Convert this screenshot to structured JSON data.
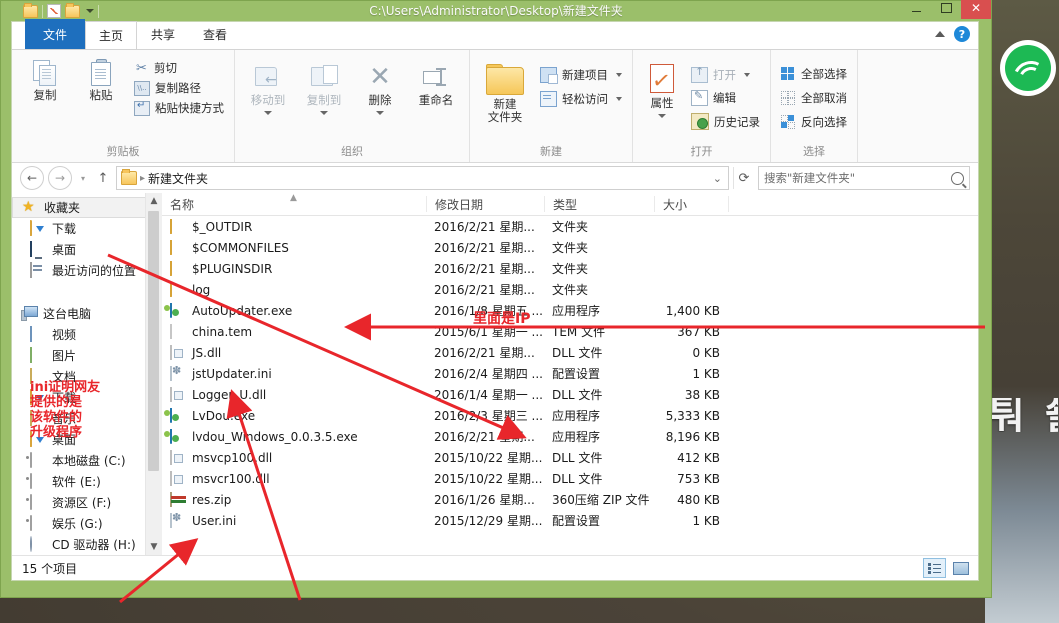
{
  "window": {
    "title": "C:\\Users\\Administrator\\Desktop\\新建文件夹",
    "minimize": "—",
    "maximize": "▢",
    "close": "✕"
  },
  "ribbon": {
    "tabs": [
      {
        "label": "文件",
        "type": "file"
      },
      {
        "label": "主页",
        "type": "active"
      },
      {
        "label": "共享",
        "type": "normal"
      },
      {
        "label": "查看",
        "type": "normal"
      }
    ],
    "collapse_icon": "chevron-up-icon",
    "help_label": "?",
    "groups": [
      {
        "name": "剪贴板",
        "big": [
          {
            "label": "复制",
            "icon": "copy-icon"
          },
          {
            "label": "粘贴",
            "icon": "paste-icon"
          }
        ],
        "small": [
          {
            "label": "剪切",
            "icon": "scissors-icon"
          },
          {
            "label": "复制路径",
            "icon": "copy-path-icon"
          },
          {
            "label": "粘贴快捷方式",
            "icon": "paste-shortcut-icon"
          }
        ]
      },
      {
        "name": "组织",
        "big": [
          {
            "label": "移动到",
            "icon": "move-to-icon"
          },
          {
            "label": "复制到",
            "icon": "copy-to-icon"
          },
          {
            "label": "删除",
            "icon": "delete-icon"
          },
          {
            "label": "重命名",
            "icon": "rename-icon"
          }
        ]
      },
      {
        "name": "新建",
        "big": [
          {
            "label": "新建\n文件夹",
            "icon": "new-folder-icon"
          }
        ],
        "small": [
          {
            "label": "新建项目",
            "icon": "new-item-icon"
          },
          {
            "label": "轻松访问",
            "icon": "easy-access-icon"
          }
        ]
      },
      {
        "name": "打开",
        "big": [
          {
            "label": "属性",
            "icon": "properties-icon"
          }
        ],
        "small": [
          {
            "label": "打开",
            "icon": "open-icon"
          },
          {
            "label": "编辑",
            "icon": "edit-icon"
          },
          {
            "label": "历史记录",
            "icon": "history-icon"
          }
        ]
      },
      {
        "name": "选择",
        "small": [
          {
            "label": "全部选择",
            "icon": "select-all-icon"
          },
          {
            "label": "全部取消",
            "icon": "select-none-icon"
          },
          {
            "label": "反向选择",
            "icon": "invert-selection-icon"
          }
        ]
      }
    ]
  },
  "navbar": {
    "back_icon": "arrow-left-icon",
    "forward_icon": "arrow-right-icon",
    "recent_icon": "chevron-down-icon",
    "up_icon": "arrow-up-icon",
    "breadcrumb": [
      "新建文件夹"
    ],
    "dropdown_icon": "chevron-down-icon",
    "refresh_icon": "refresh-icon",
    "search_placeholder": "搜索\"新建文件夹\"",
    "search_value": "",
    "search_icon": "magnifier-icon"
  },
  "sidebar": {
    "items": [
      {
        "label": "收藏夹",
        "icon": "star-icon",
        "level": 0,
        "selected": false
      },
      {
        "label": "下载",
        "icon": "folder-download-icon",
        "level": 1,
        "selected": false
      },
      {
        "label": "桌面",
        "icon": "desktop-icon",
        "level": 1,
        "selected": false
      },
      {
        "label": "最近访问的位置",
        "icon": "recent-places-icon",
        "level": 1,
        "selected": false
      },
      {
        "label": "",
        "icon": "spacer",
        "level": 1,
        "selected": false
      },
      {
        "label": "这台电脑",
        "icon": "this-pc-icon",
        "level": 0,
        "selected": false
      },
      {
        "label": "视频",
        "icon": "videos-icon",
        "level": 1,
        "selected": false
      },
      {
        "label": "图片",
        "icon": "pictures-icon",
        "level": 1,
        "selected": false
      },
      {
        "label": "文档",
        "icon": "documents-icon",
        "level": 1,
        "selected": false
      },
      {
        "label": "下载",
        "icon": "folder-download-icon",
        "level": 1,
        "selected": false
      },
      {
        "label": "音乐",
        "icon": "music-icon",
        "level": 1,
        "selected": false
      },
      {
        "label": "桌面",
        "icon": "folder-desktop-icon",
        "level": 1,
        "selected": false
      },
      {
        "label": "本地磁盘 (C:)",
        "icon": "drive-icon",
        "level": 1,
        "selected": false
      },
      {
        "label": "软件 (E:)",
        "icon": "drive-icon",
        "level": 1,
        "selected": false
      },
      {
        "label": "资源区 (F:)",
        "icon": "drive-icon",
        "level": 1,
        "selected": false
      },
      {
        "label": "娱乐 (G:)",
        "icon": "drive-icon",
        "level": 1,
        "selected": false
      },
      {
        "label": "CD 驱动器 (H:)",
        "icon": "cd-drive-icon",
        "level": 1,
        "selected": false
      }
    ],
    "scroll_up_icon": "chevron-up-icon",
    "scroll_down_icon": "chevron-down-icon"
  },
  "filelist": {
    "columns": [
      "名称",
      "修改日期",
      "类型",
      "大小"
    ],
    "sort_indicator": "ascending",
    "rows": [
      {
        "name": "$_OUTDIR",
        "icon": "folder-icon",
        "date": "2016/2/21 星期...",
        "type": "文件夹",
        "size": ""
      },
      {
        "name": "$COMMONFILES",
        "icon": "folder-icon",
        "date": "2016/2/21 星期...",
        "type": "文件夹",
        "size": ""
      },
      {
        "name": "$PLUGINSDIR",
        "icon": "folder-icon",
        "date": "2016/2/21 星期...",
        "type": "文件夹",
        "size": ""
      },
      {
        "name": "log",
        "icon": "folder-icon",
        "date": "2016/2/21 星期...",
        "type": "文件夹",
        "size": ""
      },
      {
        "name": "AutoUpdater.exe",
        "icon": "exe-icon",
        "date": "2016/1/8 星期五 ...",
        "type": "应用程序",
        "size": "1,400 KB"
      },
      {
        "name": "china.tem",
        "icon": "blank-file-icon",
        "date": "2015/6/1 星期一 ...",
        "type": "TEM 文件",
        "size": "367 KB"
      },
      {
        "name": "JS.dll",
        "icon": "dll-icon",
        "date": "2016/2/21 星期...",
        "type": "DLL 文件",
        "size": "0 KB"
      },
      {
        "name": "jstUpdater.ini",
        "icon": "ini-icon",
        "date": "2016/2/4 星期四 ...",
        "type": "配置设置",
        "size": "1 KB"
      },
      {
        "name": "Logger_U.dll",
        "icon": "dll-icon",
        "date": "2016/1/4 星期一 ...",
        "type": "DLL 文件",
        "size": "38 KB"
      },
      {
        "name": "LvDou.exe",
        "icon": "exe-icon",
        "date": "2016/2/3 星期三 ...",
        "type": "应用程序",
        "size": "5,333 KB"
      },
      {
        "name": "lvdou_Windows_0.0.3.5.exe",
        "icon": "exe-icon",
        "date": "2016/2/21 星期...",
        "type": "应用程序",
        "size": "8,196 KB"
      },
      {
        "name": "msvcp100.dll",
        "icon": "dll-icon",
        "date": "2015/10/22 星期...",
        "type": "DLL 文件",
        "size": "412 KB"
      },
      {
        "name": "msvcr100.dll",
        "icon": "dll-icon",
        "date": "2015/10/22 星期...",
        "type": "DLL 文件",
        "size": "753 KB"
      },
      {
        "name": "res.zip",
        "icon": "zip-icon",
        "date": "2016/1/26 星期...",
        "type": "360压缩 ZIP 文件",
        "size": "480 KB"
      },
      {
        "name": "User.ini",
        "icon": "ini-icon",
        "date": "2015/12/29 星期...",
        "type": "配置设置",
        "size": "1 KB"
      }
    ]
  },
  "statusbar": {
    "item_count": "15 个项目",
    "view_details_icon": "details-view-icon",
    "view_tiles_icon": "large-icons-view-icon"
  },
  "annotations": {
    "left_note": "ini证明网友\n提供的是\n该软件的\n升级程序",
    "middle_note": "里面是IP",
    "color": "#e8262b"
  },
  "desktop": {
    "spotify_icon": "spotify-icon",
    "wallpaper_glyphs": "퉈 쇎"
  }
}
